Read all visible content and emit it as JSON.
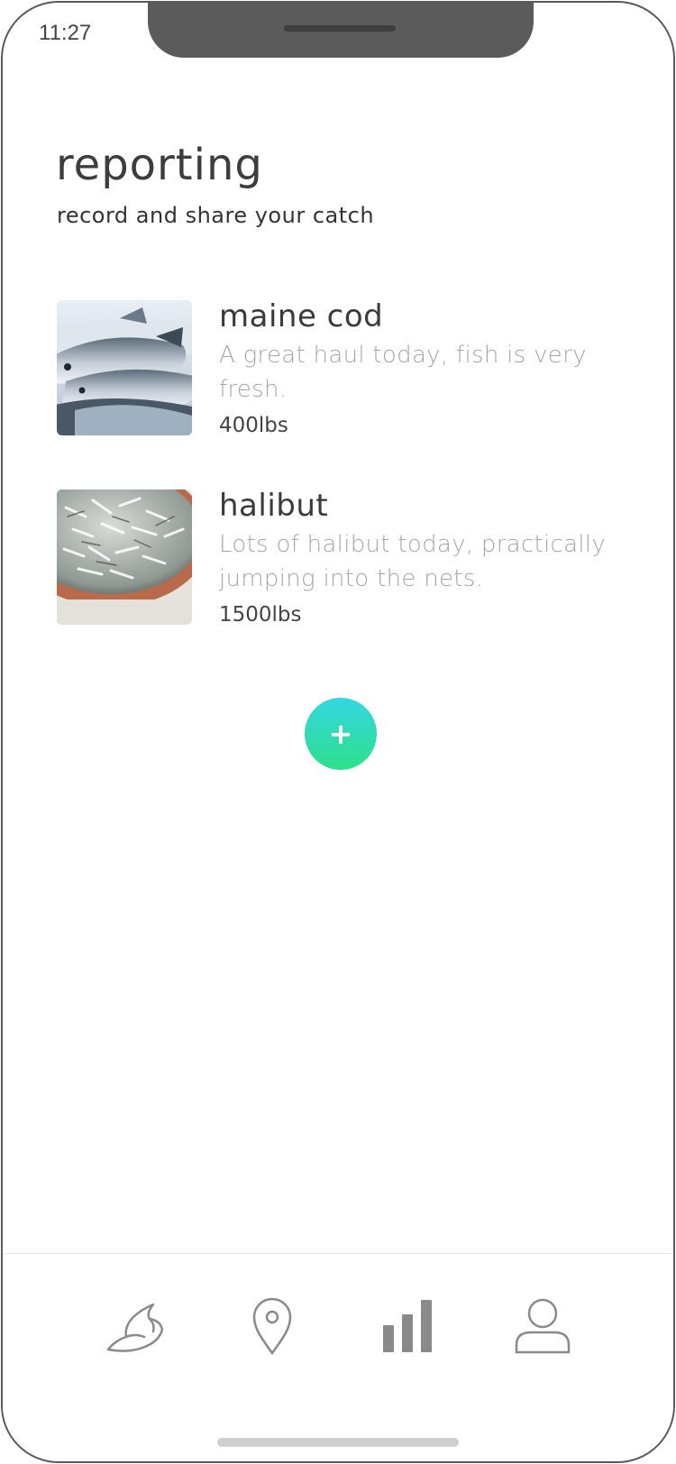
{
  "status_bar": {
    "time": "11:27"
  },
  "header": {
    "title": "reporting",
    "subtitle": "record and share your catch"
  },
  "catches": [
    {
      "name": "maine cod",
      "description": "A great haul today, fish is very fresh.",
      "weight": "400lbs",
      "image_icon": "fish-photo-cod"
    },
    {
      "name": "halibut",
      "description": "Lots of halibut today, practically jumping into the nets.",
      "weight": "1500lbs",
      "image_icon": "fish-photo-halibut"
    }
  ],
  "add_button": {
    "label": "+",
    "icon": "plus-icon"
  },
  "tab_bar": {
    "items": [
      {
        "icon": "fish-icon"
      },
      {
        "icon": "map-pin-icon"
      },
      {
        "icon": "bar-chart-icon",
        "active": true
      },
      {
        "icon": "user-icon"
      }
    ]
  },
  "colors": {
    "accent_top": "#35d6e0",
    "accent_bottom": "#2de08a",
    "title": "#3d3d3d",
    "description": "#a6a6a6",
    "icon": "#8a8a8a"
  }
}
